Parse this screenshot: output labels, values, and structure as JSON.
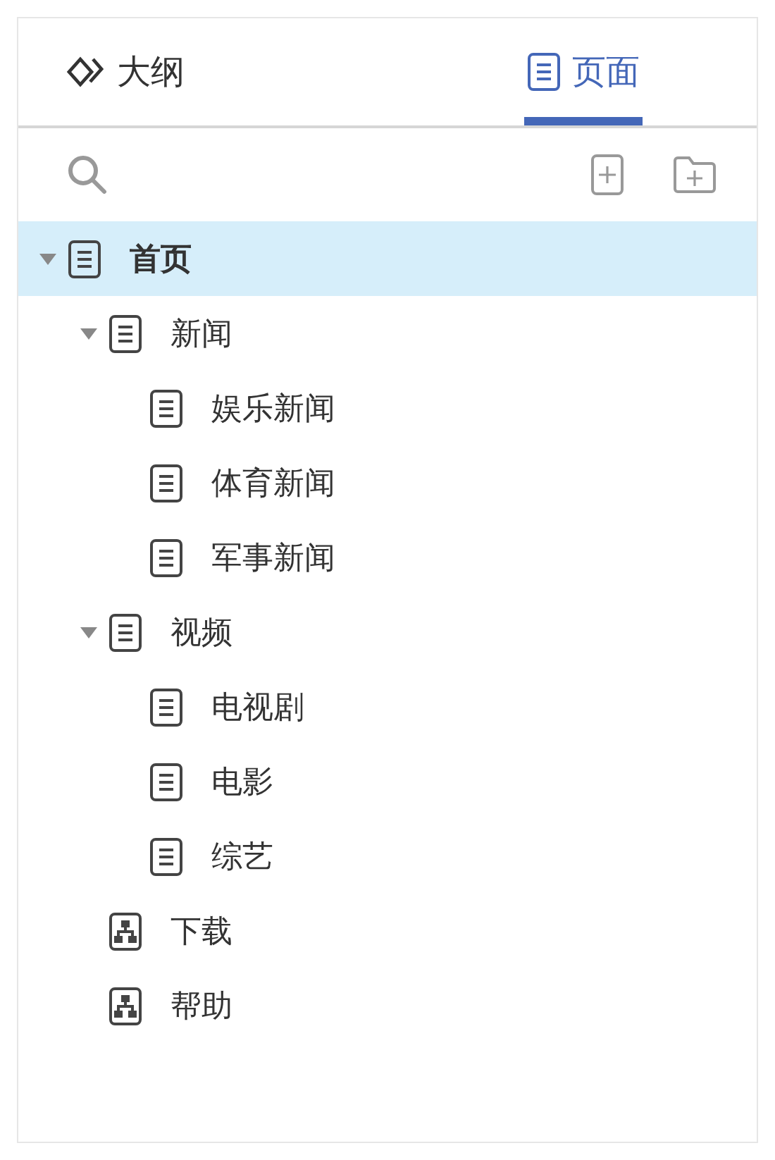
{
  "tabs": [
    {
      "label": "大纲",
      "kind": "outline",
      "selected": false
    },
    {
      "label": "页面",
      "kind": "pages",
      "selected": true
    }
  ],
  "toolbar": {
    "buttons": [
      {
        "kind": "add-page"
      },
      {
        "kind": "add-folder"
      }
    ]
  },
  "tree": [
    {
      "label": "首页",
      "kind": "page",
      "selected": true,
      "expanded": true,
      "children": [
        {
          "label": "新闻",
          "kind": "page",
          "selected": false,
          "expanded": true,
          "children": [
            {
              "label": "娱乐新闻",
              "kind": "page",
              "selected": false
            },
            {
              "label": "体育新闻",
              "kind": "page",
              "selected": false
            },
            {
              "label": "军事新闻",
              "kind": "page",
              "selected": false
            }
          ]
        },
        {
          "label": "视频",
          "kind": "page",
          "selected": false,
          "expanded": true,
          "children": [
            {
              "label": "电视剧",
              "kind": "page",
              "selected": false
            },
            {
              "label": "电影",
              "kind": "page",
              "selected": false
            },
            {
              "label": "综艺",
              "kind": "page",
              "selected": false
            }
          ]
        },
        {
          "label": "下载",
          "kind": "flow",
          "selected": false
        },
        {
          "label": "帮助",
          "kind": "flow",
          "selected": false
        }
      ]
    }
  ]
}
